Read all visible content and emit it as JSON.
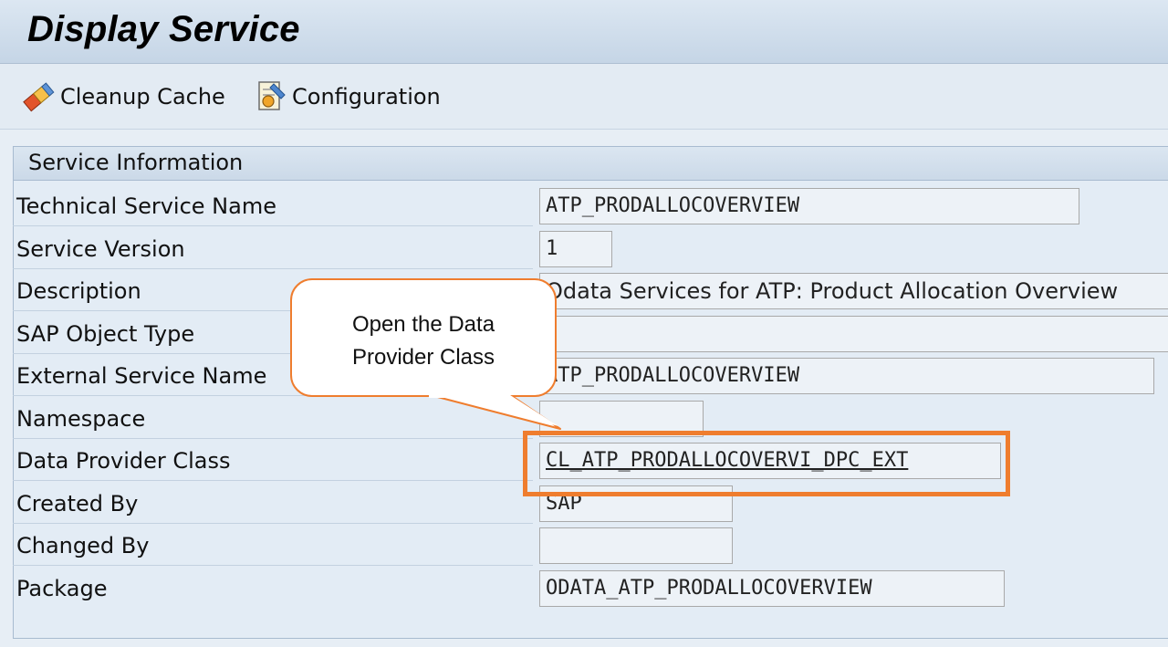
{
  "window": {
    "title": "Display Service"
  },
  "toolbar": {
    "cleanup_cache_label": "Cleanup Cache",
    "configuration_label": "Configuration"
  },
  "panel": {
    "header": "Service Information",
    "fields": [
      {
        "label": "Technical Service Name",
        "value": "ATP_PRODALLOCOVERVIEW"
      },
      {
        "label": "Service Version",
        "value": "1"
      },
      {
        "label": "Description",
        "value": "Odata Services for ATP: Product Allocation Overview"
      },
      {
        "label": "SAP Object Type",
        "value": ""
      },
      {
        "label": "External Service Name",
        "value": "ATP_PRODALLOCOVERVIEW"
      },
      {
        "label": "Namespace",
        "value": ""
      },
      {
        "label": "Data Provider Class",
        "value": "CL_ATP_PRODALLOCOVERVI_DPC_EXT"
      },
      {
        "label": "Created By",
        "value": "SAP"
      },
      {
        "label": "Changed By",
        "value": ""
      },
      {
        "label": "Package",
        "value": "ODATA_ATP_PRODALLOCOVERVIEW"
      }
    ]
  },
  "annotation": {
    "callout_line1": "Open the Data",
    "callout_line2": "Provider Class",
    "accent_color": "#ef7d2e"
  },
  "colors": {
    "title_bar": "#c5d5e6",
    "panel_bg": "#e3ecf5",
    "field_bg": "#edf2f7"
  },
  "icons": {
    "cleanup_cache": "eraser-icon",
    "configuration": "configuration-document-icon"
  }
}
